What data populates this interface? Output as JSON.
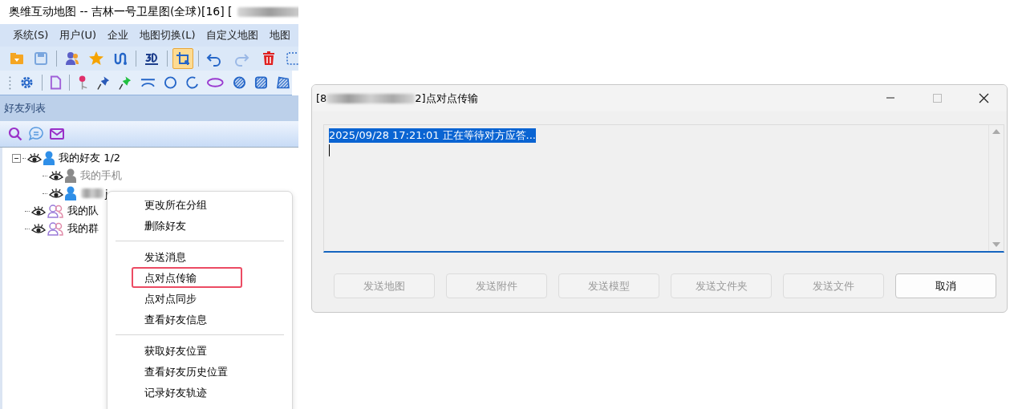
{
  "app_window": {
    "title": "奥维互动地图 -- 吉林一号卫星图(全球)[16] [",
    "menu": [
      "系统(S)",
      "用户(U)",
      "企业",
      "地图切换(L)",
      "自定义地图",
      "地图"
    ],
    "toolbar_1": [
      {
        "selected": false
      },
      {
        "selected": false
      },
      {
        "selected": false
      },
      {
        "selected": false
      },
      {
        "selected": false
      },
      {
        "selected": false
      },
      {
        "selected": true
      },
      {
        "selected": false
      },
      {
        "selected": false
      },
      {
        "selected": false
      },
      {
        "selected": false
      }
    ],
    "friends_panel": {
      "title": "好友列表",
      "tree": [
        {
          "label": "我的好友 1/2",
          "kind": "person",
          "online": true,
          "expanded": true,
          "children": [
            {
              "label": "我的手机",
              "kind": "person",
              "online": false
            },
            {
              "label": "j",
              "kind": "person",
              "online": true,
              "redacted": true
            }
          ]
        },
        {
          "label": "我的队",
          "kind": "people"
        },
        {
          "label": "我的群",
          "kind": "people"
        }
      ]
    }
  },
  "context_menu": [
    [
      {
        "label": "更改所在分组",
        "selected": false,
        "disabled": false
      },
      {
        "label": "删除好友",
        "selected": false,
        "disabled": false
      }
    ],
    [
      {
        "label": "发送消息",
        "selected": false,
        "disabled": false
      },
      {
        "label": "点对点传输",
        "selected": true,
        "disabled": false
      },
      {
        "label": "点对点同步",
        "selected": false,
        "disabled": false
      },
      {
        "label": "查看好友信息",
        "selected": false,
        "disabled": false
      }
    ],
    [
      {
        "label": "获取好友位置",
        "selected": false,
        "disabled": false
      },
      {
        "label": "查看好友历史位置",
        "selected": false,
        "disabled": false
      },
      {
        "label": "记录好友轨迹",
        "selected": false,
        "disabled": false
      }
    ]
  ],
  "dialog": {
    "title_start": "[8",
    "title_end": "2]点对点传输",
    "log": [
      {
        "text": "2025/09/28 17:21:01 正在等待对方应答...",
        "selected": true
      }
    ],
    "buttons": [
      {
        "label": "发送地图",
        "disabled": true
      },
      {
        "label": "发送附件",
        "disabled": true
      },
      {
        "label": "发送模型",
        "disabled": true
      },
      {
        "label": "发送文件夹",
        "disabled": true
      },
      {
        "label": "发送文件",
        "disabled": true
      },
      {
        "label": "取消",
        "disabled": false
      }
    ]
  }
}
